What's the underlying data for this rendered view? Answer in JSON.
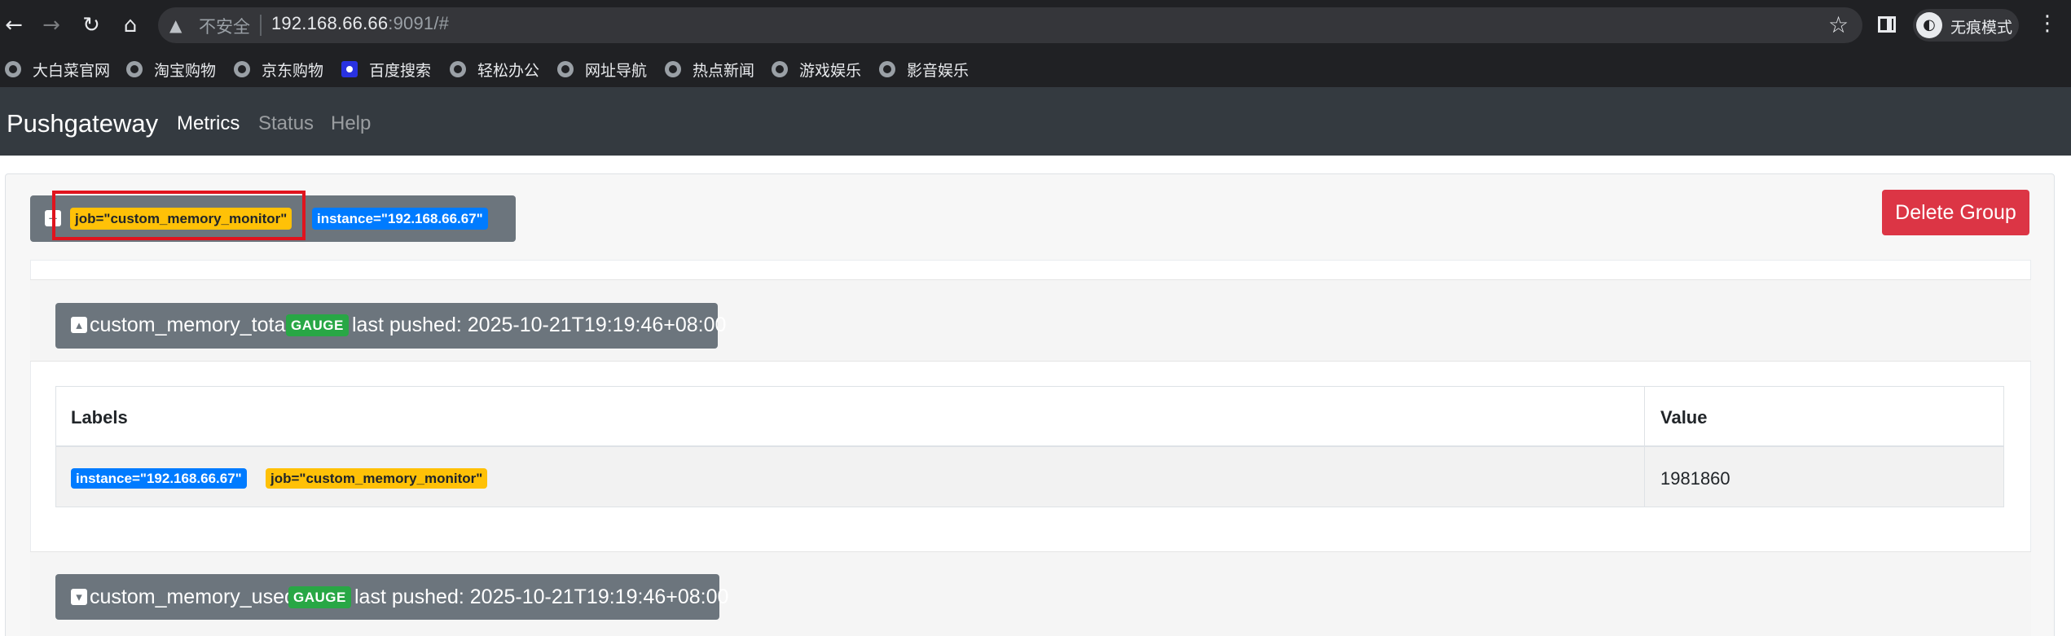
{
  "browser": {
    "insecure_label": "不安全",
    "url_host": "192.168.66.66",
    "url_rest": ":9091/#",
    "incognito_label": "无痕模式",
    "icons": [
      "back-icon",
      "forward-icon",
      "reload-icon",
      "home-icon",
      "warning-icon",
      "star-icon",
      "sidepanel-icon",
      "incognito-icon",
      "menu-icon"
    ]
  },
  "bookmarks": [
    {
      "label": "大白菜官网"
    },
    {
      "label": "淘宝购物"
    },
    {
      "label": "京东购物"
    },
    {
      "label": "百度搜索"
    },
    {
      "label": "轻松办公"
    },
    {
      "label": "网址导航"
    },
    {
      "label": "热点新闻"
    },
    {
      "label": "游戏娱乐"
    },
    {
      "label": "影音娱乐"
    }
  ],
  "navbar": {
    "brand": "Pushgateway",
    "links": [
      {
        "label": "Metrics",
        "active": true
      },
      {
        "label": "Status",
        "active": false
      },
      {
        "label": "Help",
        "active": false
      }
    ]
  },
  "group": {
    "job_badge": "job=\"custom_memory_monitor\"",
    "instance_badge": "instance=\"192.168.66.67\"",
    "delete_label": "Delete Group"
  },
  "metrics": [
    {
      "name": "custom_memory_total",
      "type": "GAUGE",
      "pushed": "last pushed: 2025-10-21T19:19:46+08:00",
      "table": {
        "headers": [
          "Labels",
          "Value"
        ],
        "rows": [
          {
            "labels": [
              "instance=\"192.168.66.67\"",
              "job=\"custom_memory_monitor\""
            ],
            "value": "1981860"
          }
        ]
      }
    },
    {
      "name": "custom_memory_used",
      "type": "GAUGE",
      "pushed": "last pushed: 2025-10-21T19:19:46+08:00"
    }
  ],
  "colors": {
    "navbar": "#343a40",
    "job_badge": "#ffc107",
    "instance_badge": "#007bff",
    "gauge_badge": "#28a745",
    "danger": "#dc3545",
    "highlight": "#e0141e"
  }
}
